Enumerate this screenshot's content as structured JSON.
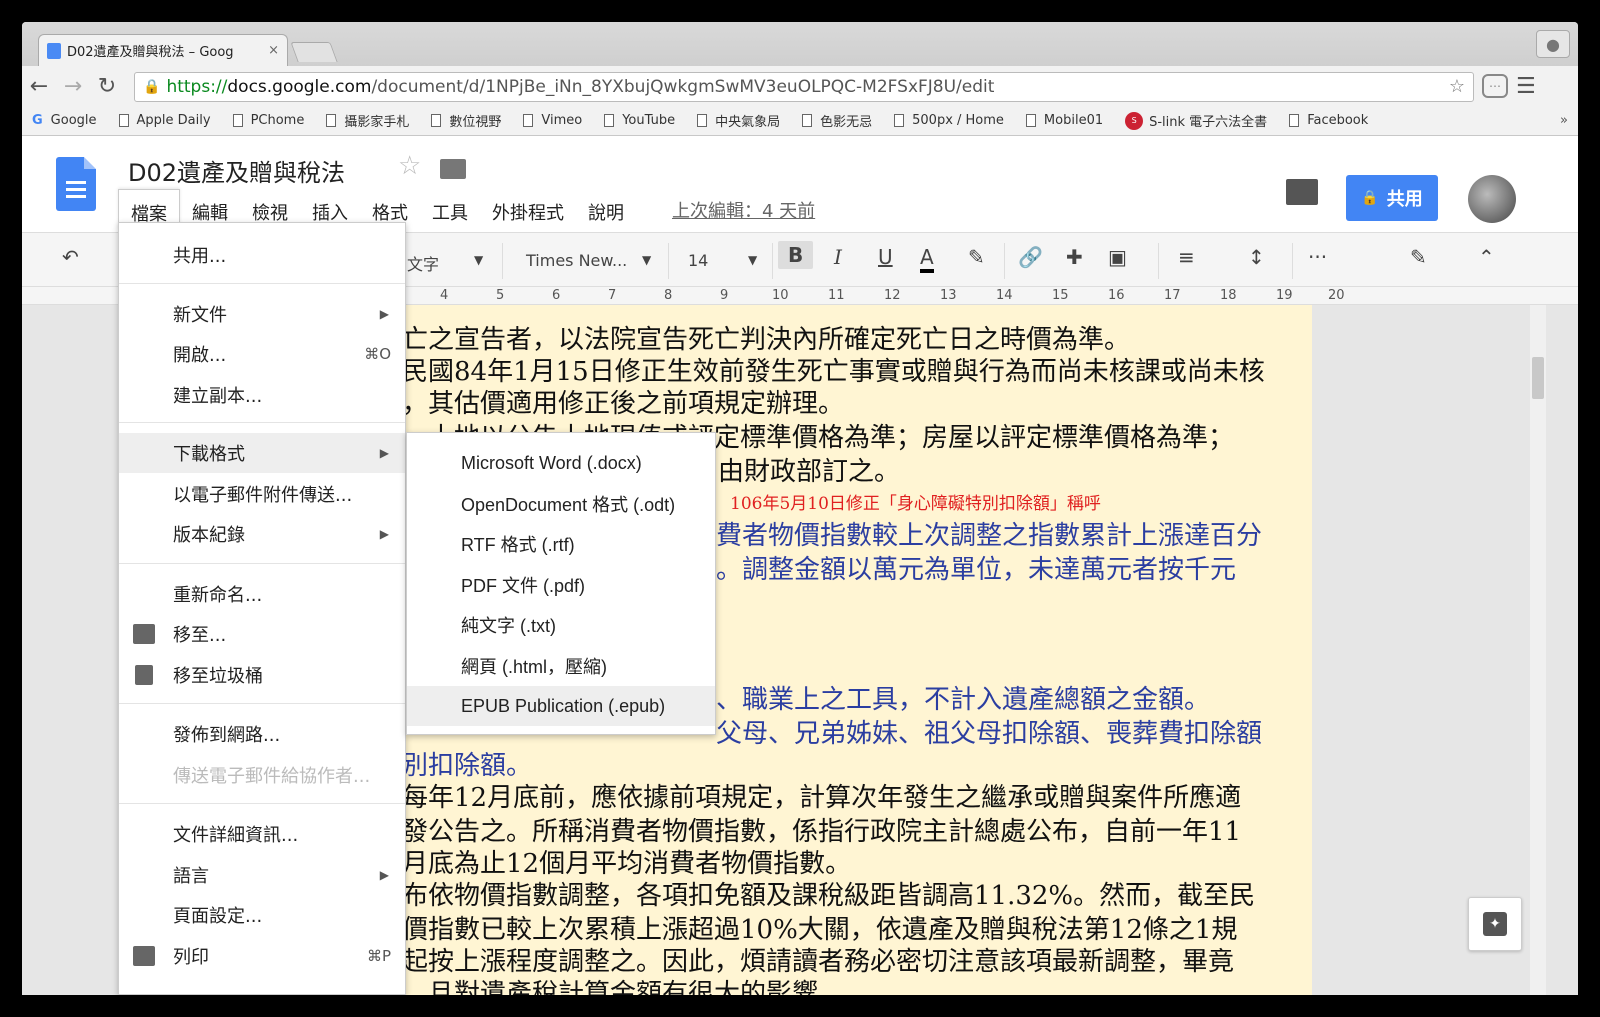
{
  "browser": {
    "tab_title": "D02遺產及贈與稅法 – Goog",
    "tab_close": "×",
    "url_scheme": "https://",
    "url_host": "docs.google.com",
    "url_path": "/document/d/1NPjBe_iNn_8YXbujQwkgmSwMV3euOLPQC-M2FSxFJ8U/edit",
    "bookmarks": [
      "Google",
      "Apple Daily",
      "PChome",
      "攝影家手札",
      "數位視野",
      "Vimeo",
      "YouTube",
      "中央氣象局",
      "色影无忌",
      "500px / Home",
      "Mobile01",
      "S-link 電子六法全書",
      "Facebook"
    ],
    "bookmarks_more": "»"
  },
  "docs": {
    "title": "D02遺產及贈與稅法",
    "menu": [
      "檔案",
      "編輯",
      "檢視",
      "插入",
      "格式",
      "工具",
      "外掛程式",
      "說明"
    ],
    "last_edit": "上次編輯：4 天前",
    "share_label": "共用"
  },
  "toolbar": {
    "style_value": "文字",
    "font_value": "Times New...",
    "size_value": "14",
    "bold": "B",
    "italic": "I",
    "underline": "U",
    "text_color": "A",
    "more": "···"
  },
  "ruler": [
    "4",
    "5",
    "6",
    "7",
    "8",
    "9",
    "10",
    "11",
    "12",
    "13",
    "14",
    "15",
    "16",
    "17",
    "18",
    "19",
    "20"
  ],
  "file_menu": {
    "share": "共用...",
    "new_doc": "新文件",
    "open": "開啟...",
    "open_shortcut": "⌘O",
    "copy": "建立副本...",
    "download": "下載格式",
    "email_attach": "以電子郵件附件傳送...",
    "version": "版本紀錄",
    "rename": "重新命名...",
    "move": "移至...",
    "trash": "移至垃圾桶",
    "publish": "發佈到網路...",
    "email_collab": "傳送電子郵件給協作者...",
    "details": "文件詳細資訊...",
    "language": "語言",
    "page_setup": "頁面設定...",
    "print": "列印",
    "print_shortcut": "⌘P"
  },
  "download_submenu": [
    "Microsoft Word (.docx)",
    "OpenDocument 格式 (.odt)",
    "RTF 格式 (.rtf)",
    "PDF 文件 (.pdf)",
    "純文字 (.txt)",
    "網頁 (.html，壓縮)",
    "EPUB Publication (.epub)"
  ],
  "document_lines": {
    "l1": "亡之宣告者，以法院宣告死亡判決內所確定死亡日之時價為準。",
    "l2": "民國84年1月15日修正生效前發生死亡事實或贈與行為而尚未核課或尚未核",
    "l3": "，其估價適用修正後之前項規定辦理。",
    "l4": "，土地以公告土地現值或評定標準價格為準；房屋以評定標準價格為準；",
    "l5": "由財政部訂之。",
    "note": "106年5月10日修正「身心障礙特別扣除額」稱呼",
    "l6": "費者物價指數較上次調整之指數累計上漲達百分",
    "l7": "。調整金額以萬元為單位，未達萬元者按千元",
    "l8": "、職業上之工具，不計入遺產總額之金額。",
    "l9": "父母、兄弟姊妹、祖父母扣除額、喪葬費扣除額",
    "l10": "別扣除額。",
    "l11": "每年12月底前，應依據前項規定，計算次年發生之繼承或贈與案件所應適",
    "l12": "發公告之。所稱消費者物價指數，係指行政院主計總處公布，自前一年11",
    "l13": "月底為止12個月平均消費者物價指數。",
    "l14": "布依物價指數調整，各項扣免額及課稅級距皆調高11.32%。然而，截至民",
    "l15": "價指數已較上次累積上漲超過10%大關，依遺產及贈與稅法第12條之1規",
    "l16": "起按上漲程度調整之。因此，煩請讀者務必密切注意該項最新調整，畢竟",
    "l17": "，且對遺產稅計算金額有很大的影響。"
  },
  "colors": {
    "doc_bg": "#fff5d3",
    "accent": "#4285f4",
    "note_red": "#e02020",
    "text_blue": "#2b3ea1"
  }
}
